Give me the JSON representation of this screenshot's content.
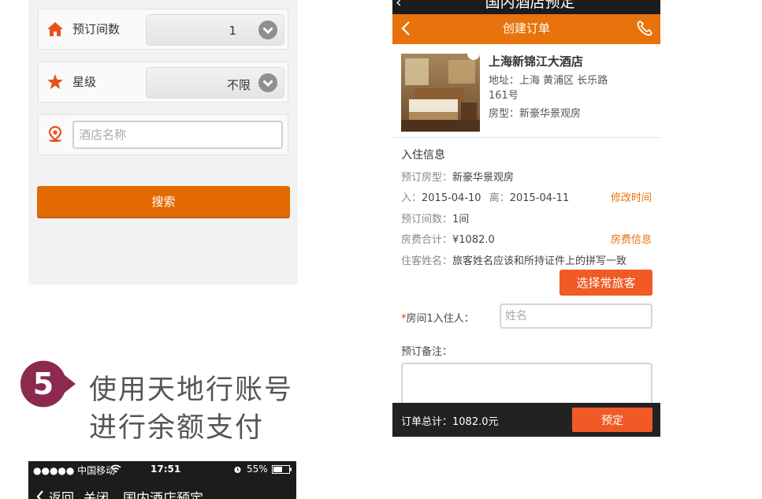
{
  "left_form": {
    "rooms_label": "预订间数",
    "rooms_value": "1",
    "star_label": "星级",
    "star_value": "不限",
    "hotel_placeholder": "酒店名称",
    "search_label": "搜索"
  },
  "step": {
    "number": "5",
    "line1": "使用天地行账号",
    "line2": "进行余额支付"
  },
  "phone2": {
    "signal": "●●●●● 中国移动",
    "time": "17:51",
    "battery": "55%",
    "back_label": "返回",
    "close_label": "关闭",
    "title": "国内酒店预定"
  },
  "order": {
    "top_title": "国内酒店预定",
    "header_title": "创建订单",
    "hotel": {
      "name": "上海新锦江大酒店",
      "address_line1": "地址：上海 黄浦区 长乐路",
      "address_line2": "161号",
      "room_type": "房型：新豪华景观房"
    },
    "checkin": {
      "section_title": "入住信息",
      "room_type_label": "预订房型：",
      "room_type_value": "新豪华景观房",
      "in_label": "入：",
      "in_date": "2015-04-10",
      "out_label": "离：",
      "out_date": "2015-04-11",
      "change_time": "修改时间",
      "rooms_label": "预订间数：",
      "rooms_value": "1间",
      "total_label": "房费合计：",
      "total_value": "¥1082.0",
      "fee_info": "房费信息",
      "guest_label": "住客姓名：",
      "guest_note": "旅客姓名应该和所持证件上的拼写一致",
      "traveler_button": "选择常旅客",
      "occupant_required": "*",
      "occupant_label": "房间1入住人：",
      "occupant_placeholder": "姓名",
      "remark_label": "预订备注："
    },
    "footer": {
      "total": "订单总计：1082.0元",
      "book_button": "预定"
    }
  },
  "colors": {
    "accent": "#e8720b",
    "button": "#f05a26",
    "badge": "#8b2a4e"
  }
}
